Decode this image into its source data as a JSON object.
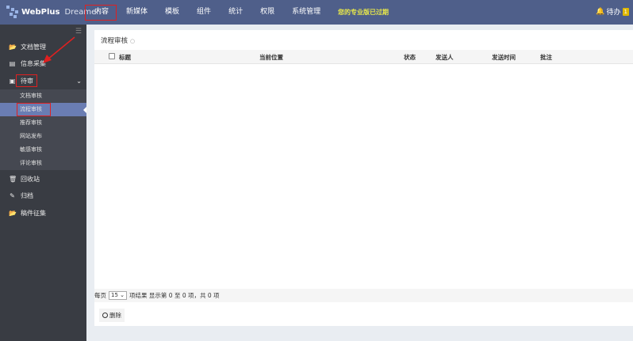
{
  "header": {
    "brand": "WebPlus",
    "brand_sub": "Dreamer",
    "nav": [
      "内容",
      "新媒体",
      "模板",
      "组件",
      "统计",
      "权限",
      "系统管理"
    ],
    "active_nav": "内容",
    "expire_notice": "您的专业版已过期",
    "todo_label": "待办",
    "todo_count": "1"
  },
  "sidebar": {
    "items": [
      {
        "label": "文档管理",
        "icon": "folder-open-icon"
      },
      {
        "label": "信息采集",
        "icon": "list-icon"
      },
      {
        "label": "待审",
        "icon": "file-icon"
      },
      {
        "label": "回收站",
        "icon": "trash-icon"
      },
      {
        "label": "归档",
        "icon": "edit-icon"
      },
      {
        "label": "稿件征集",
        "icon": "folder-open-icon"
      }
    ],
    "sub_items": [
      "文档审核",
      "流程审核",
      "推荐审核",
      "网站发布",
      "敏感审核",
      "评论审核"
    ],
    "active_sub": "流程审核"
  },
  "panel": {
    "title": "流程审核",
    "columns": [
      "标题",
      "当前位置",
      "状态",
      "发送人",
      "发送时间",
      "批注"
    ],
    "rows": [],
    "pagination": {
      "per_page_label": "每页",
      "per_page": "15",
      "suffix": "项结果 显示第 0 至 0 项，共 0 项"
    },
    "delete_label": "删除"
  },
  "colors": {
    "header": "#4f5f8a",
    "sidebar": "#393c43",
    "active": "#6a7db3",
    "annotation": "#e02020"
  }
}
